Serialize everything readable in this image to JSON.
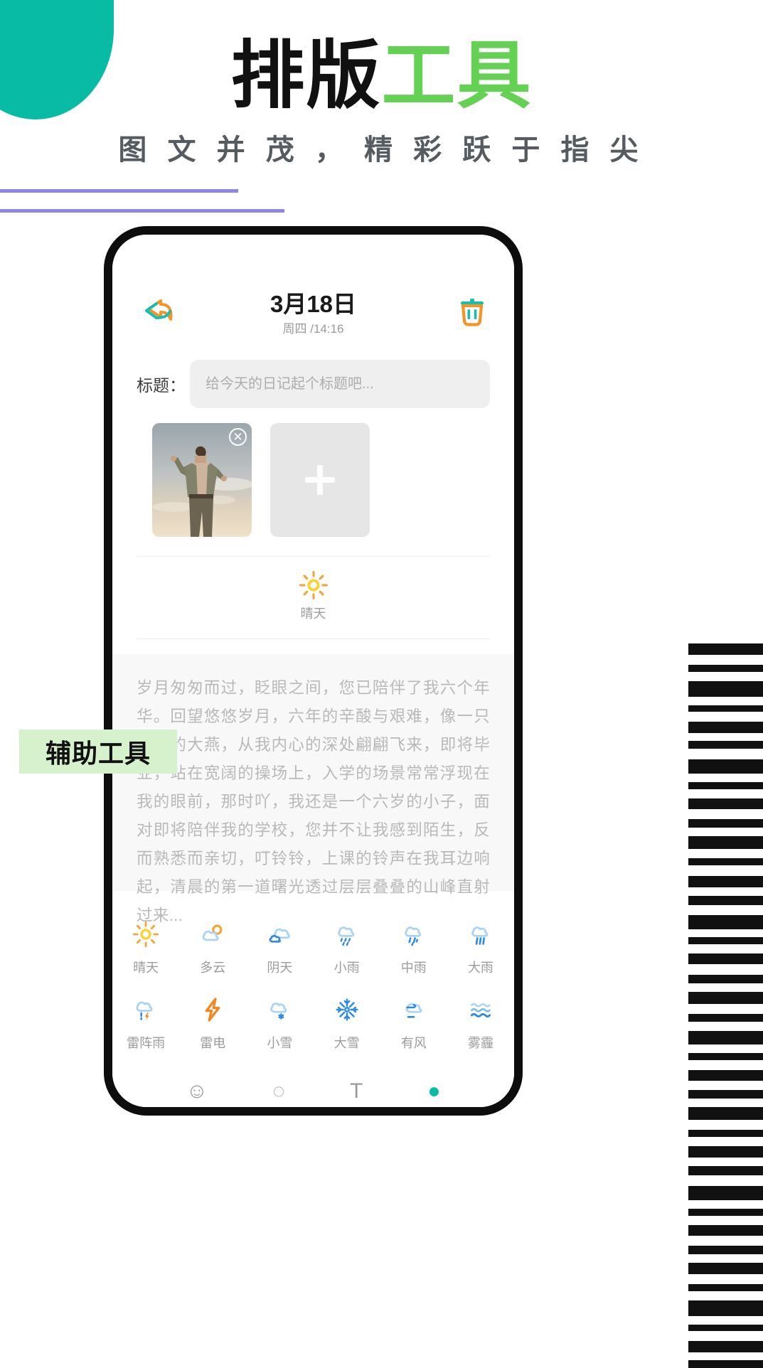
{
  "promo": {
    "headline_dark": "排版",
    "headline_accent": "工具",
    "subheadline": "图 文 并 茂 ， 精 彩 跃 于 指 尖",
    "helper_badge": "辅助工具",
    "accent_green": "#64d154",
    "accent_teal": "#07bba5",
    "accent_purple": "#8c86e8",
    "badge_bg": "#d6f2cd"
  },
  "app": {
    "navbar": {
      "back_icon": "back-reply-arrow-icon",
      "title": "3月18日",
      "subtitle": "周四 /14:16",
      "delete_icon": "trash-icon"
    },
    "title_field": {
      "label": "标题：",
      "value": "",
      "placeholder": "给今天的日记起个标题吧..."
    },
    "photos": {
      "thumb_remove_icon": "close-circle-icon",
      "add_icon": "plus-icon"
    },
    "current_weather": {
      "icon": "sun-icon",
      "label": "晴天"
    },
    "entry_text": "岁月匆匆而过，眨眼之间，您已陪伴了我六个年华。回望悠悠岁月，六年的辛酸与艰难，像一只南飞的大燕，从我内心的深处翩翩飞来，即将毕业，站在宽阔的操场上，入学的场景常常浮现在我的眼前，那时吖，我还是一个六岁的小子，面对即将陪伴我的学校，您并不让我感到陌生，反而熟悉而亲切，叮铃铃，上课的铃声在我耳边响起，清晨的第一道曙光透过层层叠叠的山峰直射过来...",
    "weather_options": [
      {
        "label": "晴天",
        "icon": "sun-icon"
      },
      {
        "label": "多云",
        "icon": "sun-behind-cloud-icon"
      },
      {
        "label": "阴天",
        "icon": "overcast-clouds-icon"
      },
      {
        "label": "小雨",
        "icon": "light-rain-icon"
      },
      {
        "label": "中雨",
        "icon": "moderate-rain-icon"
      },
      {
        "label": "大雨",
        "icon": "heavy-rain-icon"
      },
      {
        "label": "雷阵雨",
        "icon": "thunder-shower-icon"
      },
      {
        "label": "雷电",
        "icon": "lightning-bolt-icon"
      },
      {
        "label": "小雪",
        "icon": "light-snow-icon"
      },
      {
        "label": "大雪",
        "icon": "heavy-snow-icon"
      },
      {
        "label": "有风",
        "icon": "windy-icon"
      },
      {
        "label": "雾霾",
        "icon": "haze-icon"
      }
    ],
    "bottom_bar": [
      {
        "icon": "emoji-icon"
      },
      {
        "icon": "camera-icon"
      },
      {
        "icon": "text-format-icon"
      },
      {
        "icon": "check-icon"
      }
    ]
  }
}
